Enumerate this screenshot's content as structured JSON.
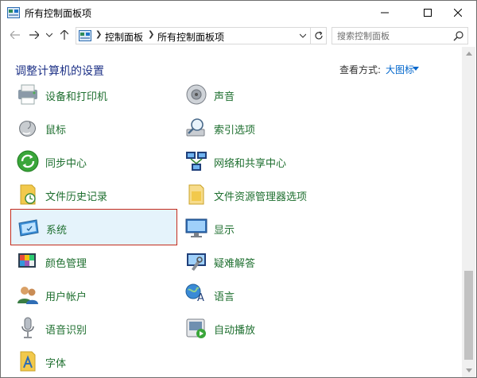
{
  "window": {
    "title": "所有控制面板项"
  },
  "address": {
    "crumbs": [
      "控制面板",
      "所有控制面板项"
    ]
  },
  "search": {
    "placeholder": "搜索控制面板"
  },
  "content": {
    "heading": "调整计算机的设置",
    "view_by_label": "查看方式:",
    "view_by_value": "大图标"
  },
  "items": {
    "left": [
      {
        "label": "设备和打印机",
        "icon": "printer-icon"
      },
      {
        "label": "鼠标",
        "icon": "mouse-icon"
      },
      {
        "label": "同步中心",
        "icon": "sync-icon"
      },
      {
        "label": "文件历史记录",
        "icon": "file-history-icon"
      },
      {
        "label": "系统",
        "icon": "system-icon"
      },
      {
        "label": "颜色管理",
        "icon": "color-management-icon"
      },
      {
        "label": "用户帐户",
        "icon": "user-accounts-icon"
      },
      {
        "label": "语音识别",
        "icon": "microphone-icon"
      },
      {
        "label": "字体",
        "icon": "fonts-icon"
      }
    ],
    "right": [
      {
        "label": "声音",
        "icon": "speaker-icon"
      },
      {
        "label": "索引选项",
        "icon": "indexing-icon"
      },
      {
        "label": "网络和共享中心",
        "icon": "network-icon"
      },
      {
        "label": "文件资源管理器选项",
        "icon": "folder-options-icon"
      },
      {
        "label": "显示",
        "icon": "display-icon"
      },
      {
        "label": "疑难解答",
        "icon": "troubleshooting-icon"
      },
      {
        "label": "语言",
        "icon": "language-icon"
      },
      {
        "label": "自动播放",
        "icon": "autoplay-icon"
      }
    ]
  },
  "colors": {
    "link_green": "#1e6f2f",
    "heading_blue": "#1e3287",
    "accent_blue": "#0066cc",
    "selection_border": "#c42b1c",
    "selection_fill": "#e5f3fb"
  }
}
